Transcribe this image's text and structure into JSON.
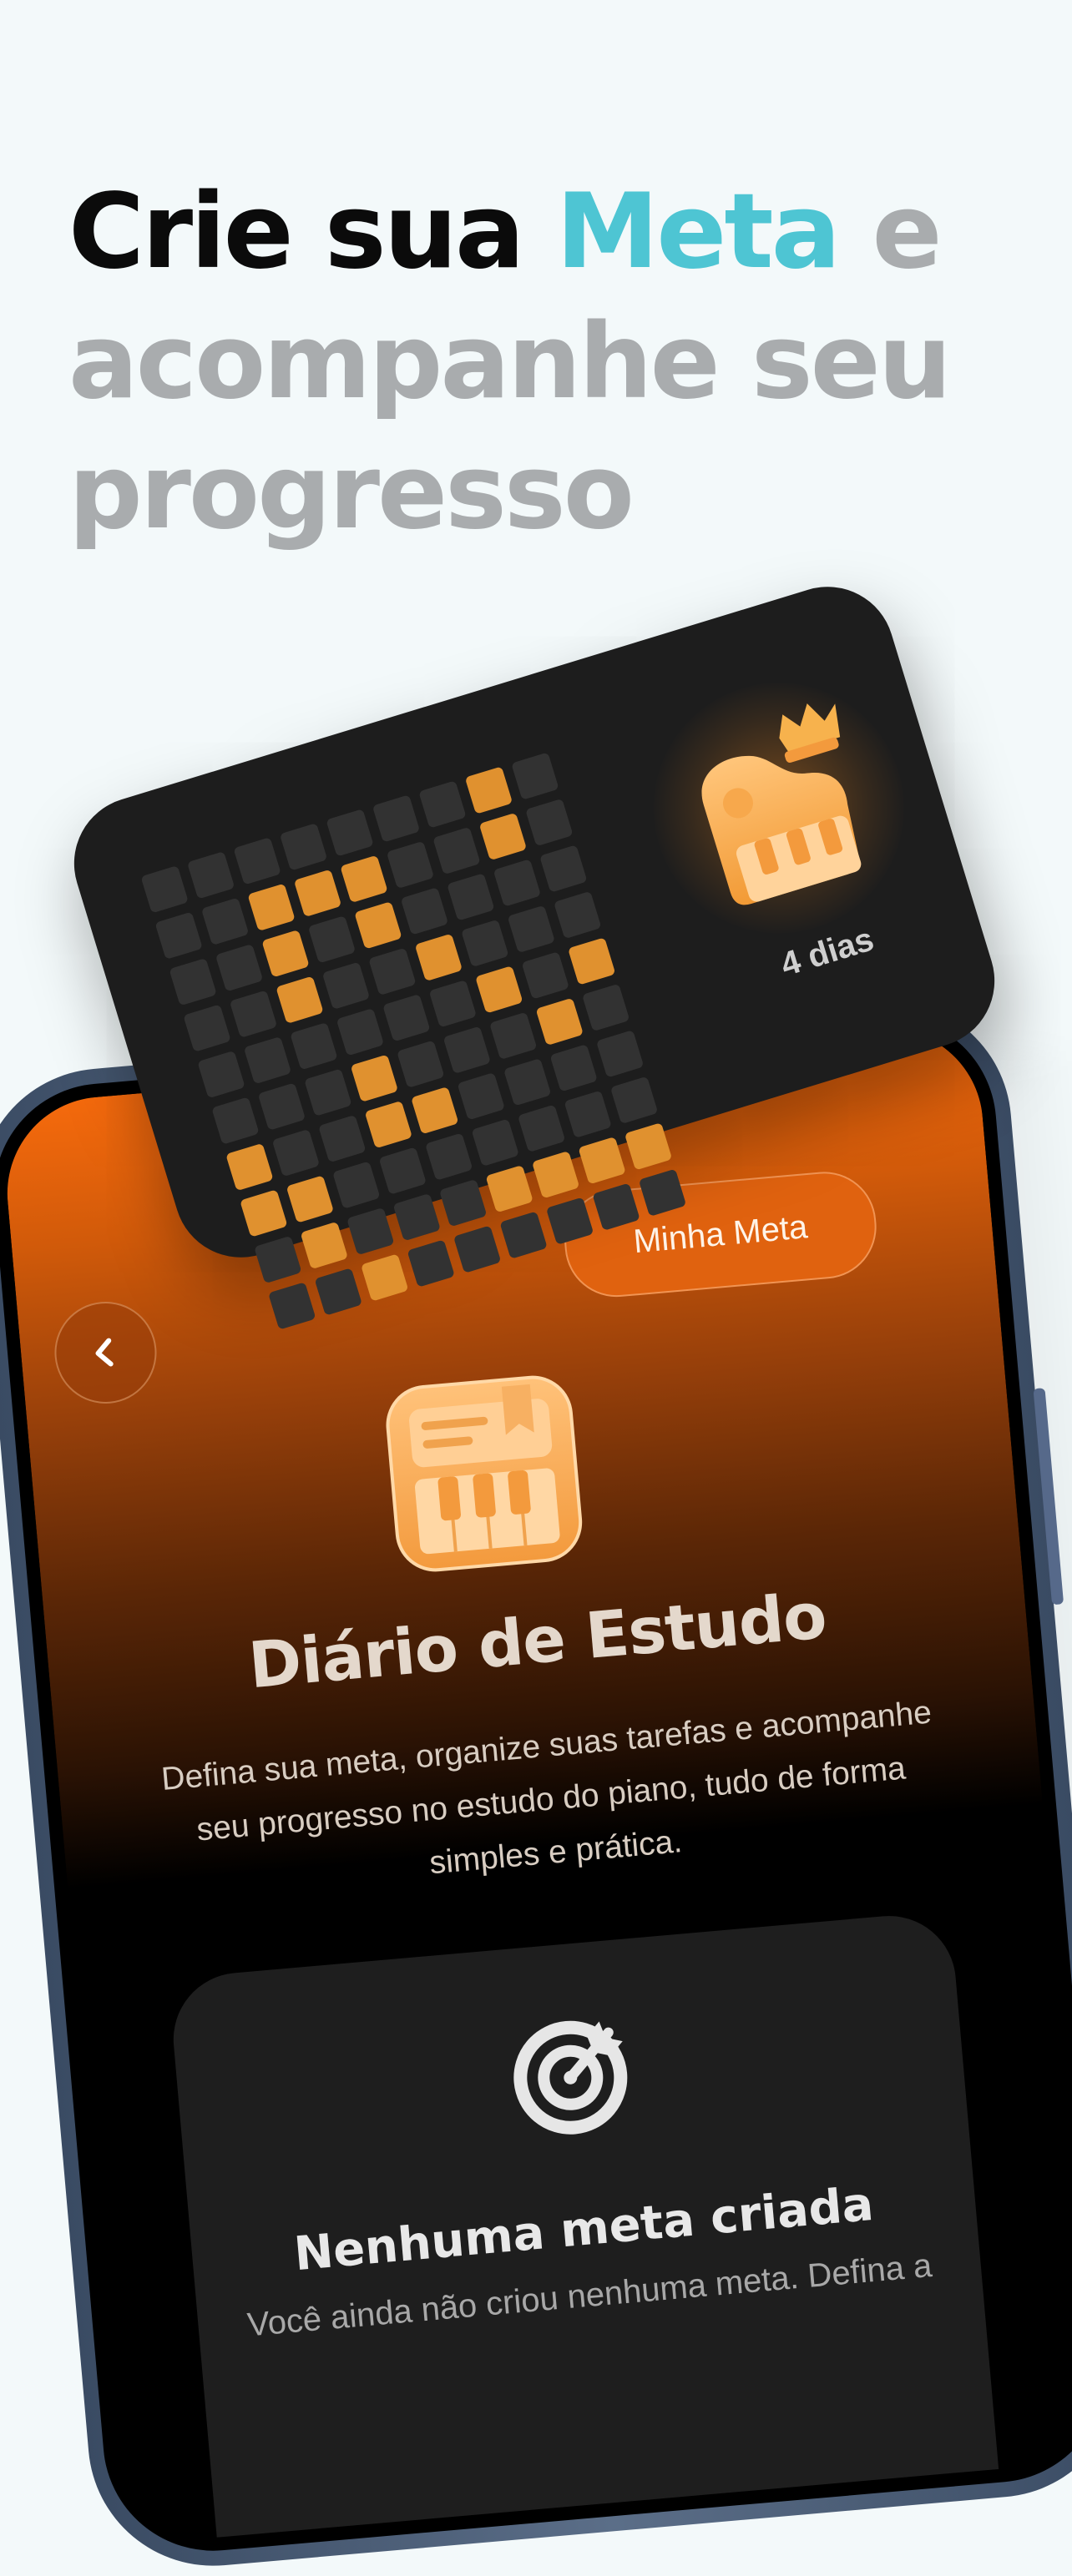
{
  "headline": {
    "part1": "Crie sua ",
    "accent": "Meta",
    "part2": " e acompanhe seu progresso"
  },
  "streak_card": {
    "days_label": "4 dias",
    "grid_rows": [
      [
        0,
        0,
        0,
        0,
        0,
        0,
        0,
        1,
        0
      ],
      [
        0,
        0,
        1,
        1,
        1,
        0,
        0,
        1,
        0
      ],
      [
        0,
        0,
        1,
        0,
        1,
        0,
        0,
        0,
        0
      ],
      [
        0,
        0,
        1,
        0,
        0,
        1,
        0,
        0,
        0
      ],
      [
        0,
        0,
        0,
        0,
        0,
        0,
        1,
        0,
        1
      ],
      [
        0,
        0,
        0,
        1,
        0,
        0,
        0,
        1,
        0
      ],
      [
        1,
        0,
        0,
        1,
        1,
        0,
        0,
        0,
        0
      ],
      [
        1,
        1,
        0,
        0,
        0,
        0,
        0,
        0,
        0
      ],
      [
        0,
        1,
        0,
        0,
        0,
        1,
        1,
        1,
        1
      ],
      [
        0,
        0,
        1,
        0,
        0,
        0,
        0,
        0,
        0
      ]
    ]
  },
  "screen": {
    "my_goal_button": "Minha Meta",
    "title": "Diário de Estudo",
    "description": "Defina sua meta, organize suas tarefas e acompanhe seu progresso no estudo do piano, tudo de forma simples e prática.",
    "empty_title": "Nenhuma meta criada",
    "empty_desc": "Você ainda não criou nenhuma meta. Defina a"
  },
  "icons": {
    "back": "chevron-left-icon",
    "journal": "piano-journal-icon",
    "streak": "piano-crown-icon",
    "target": "target-icon"
  },
  "colors": {
    "accent": "#4ec5d3",
    "orange": "#e0620f",
    "streak_on": "#e0912f"
  }
}
